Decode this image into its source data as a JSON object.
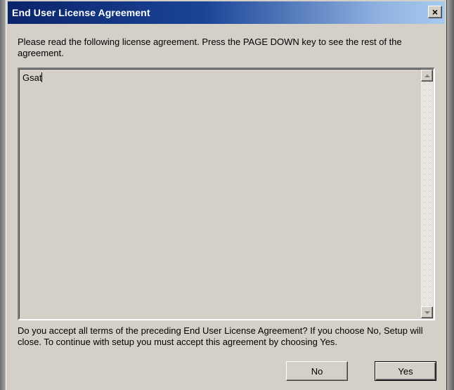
{
  "window": {
    "title": "End User License Agreement",
    "close_glyph": "×",
    "close_icon": "close-icon"
  },
  "instruction_text": "Please read the following license agreement. Press the PAGE DOWN key to see the rest of the agreement.",
  "license": {
    "text": "Gsat"
  },
  "question_text": "Do you accept all terms of the preceding End User License Agreement? If you choose No, Setup will close. To continue with setup you must accept this agreement by choosing Yes.",
  "buttons": {
    "no_label": "No",
    "yes_label": "Yes"
  },
  "colors": {
    "dialog_face": "#d4d0c8",
    "title_gradient_start": "#0a246a",
    "title_gradient_end": "#a6caf0",
    "title_text": "#ffffff"
  }
}
